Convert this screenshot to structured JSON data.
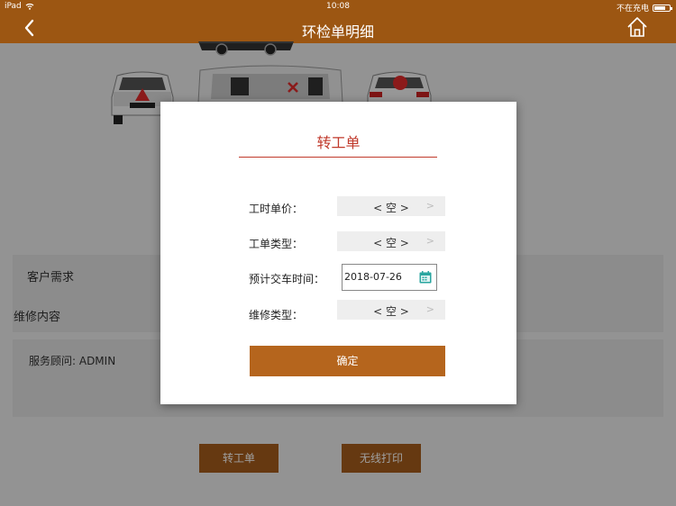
{
  "status_bar": {
    "device": "iPad",
    "time": "10:08",
    "charging": "不在充电"
  },
  "nav": {
    "title": "环检单明细"
  },
  "background": {
    "customer_request_label": "客户需求",
    "repair_content_label": "维修内容",
    "advisor_label": "服务顾问: ADMIN",
    "transfer_button": "转工单",
    "print_button": "无线打印"
  },
  "modal": {
    "title": "转工单",
    "rows": [
      {
        "label": "工时单价：",
        "value": "< 空 >",
        "arrow": ">"
      },
      {
        "label": "工单类型：",
        "value": "< 空 >",
        "arrow": ">"
      },
      {
        "label": "预计交车时间：",
        "value": "2018-07-26"
      },
      {
        "label": "维修类型：",
        "value": "< 空 >",
        "arrow": ">"
      }
    ],
    "confirm": "确定"
  },
  "icons": {
    "back": "chevron-left-icon",
    "home": "home-icon",
    "wifi": "wifi-icon",
    "battery": "battery-icon",
    "calendar": "calendar-icon"
  },
  "colors": {
    "brand_brown": "#9c5612",
    "button_brown": "#a55d1c",
    "title_red": "#c0392b",
    "marker_red": "#e02a2a",
    "calendar_teal": "#2aa6a0"
  }
}
